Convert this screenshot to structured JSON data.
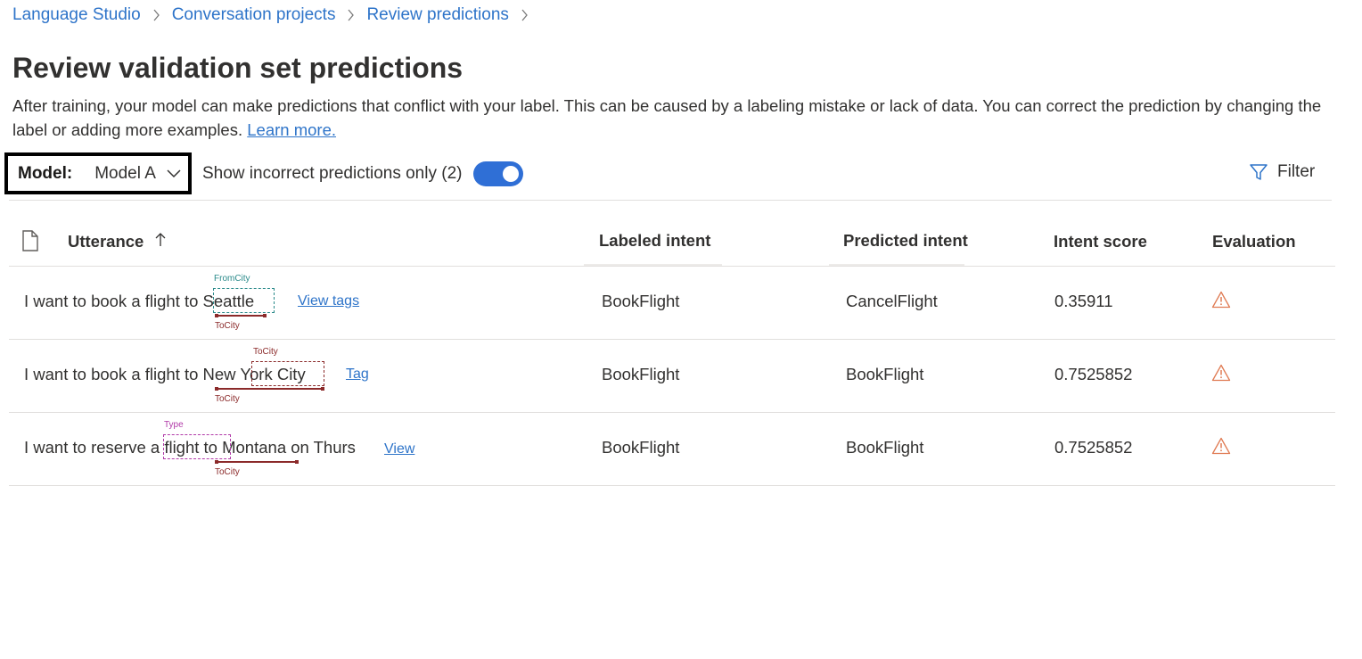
{
  "breadcrumb": [
    "Language Studio",
    "Conversation projects",
    "Review predictions"
  ],
  "title": "Review validation set predictions",
  "description": "After training, your model can make predictions that conflict with your label. This can be caused by a labeling mistake or lack of data. You can correct the prediction by changing the label or adding more examples.",
  "learn_more": "Learn more.",
  "model": {
    "label": "Model:",
    "value": "Model A"
  },
  "toggle": {
    "label": "Show incorrect predictions only (2)",
    "on": true,
    "accent": "#2f6fd6"
  },
  "filter_label": "Filter",
  "columns": {
    "utterance": "Utterance",
    "labeled": "Labeled intent",
    "predicted": "Predicted intent",
    "score": "Intent score",
    "evaluation": "Evaluation"
  },
  "rows": [
    {
      "utterance": "I want to book a flight to Seattle",
      "action": "View tags",
      "labeled": "BookFlight",
      "predicted": "CancelFlight",
      "score": "0.35911",
      "tags": {
        "above": "FromCity",
        "below": "ToCity"
      },
      "evaluation_icon": "warning-icon"
    },
    {
      "utterance": "I want to book a flight to New York City",
      "action": "Tag",
      "labeled": "BookFlight",
      "predicted": "BookFlight",
      "score": "0.7525852",
      "tags": {
        "above": "ToCity",
        "below": "ToCity"
      },
      "evaluation_icon": "warning-icon"
    },
    {
      "utterance": "I want to reserve a flight to Montana on Thurs",
      "action": "View",
      "labeled": "BookFlight",
      "predicted": "BookFlight",
      "score": "0.7525852",
      "tags": {
        "above": "Type",
        "below": "ToCity"
      },
      "evaluation_icon": "warning-icon"
    }
  ],
  "colors": {
    "link": "#2e74c9",
    "tag_from": "#2a8a8a",
    "tag_to": "#8b2a2a",
    "tag_type": "#b13aa8",
    "warning": "#e07b53"
  }
}
